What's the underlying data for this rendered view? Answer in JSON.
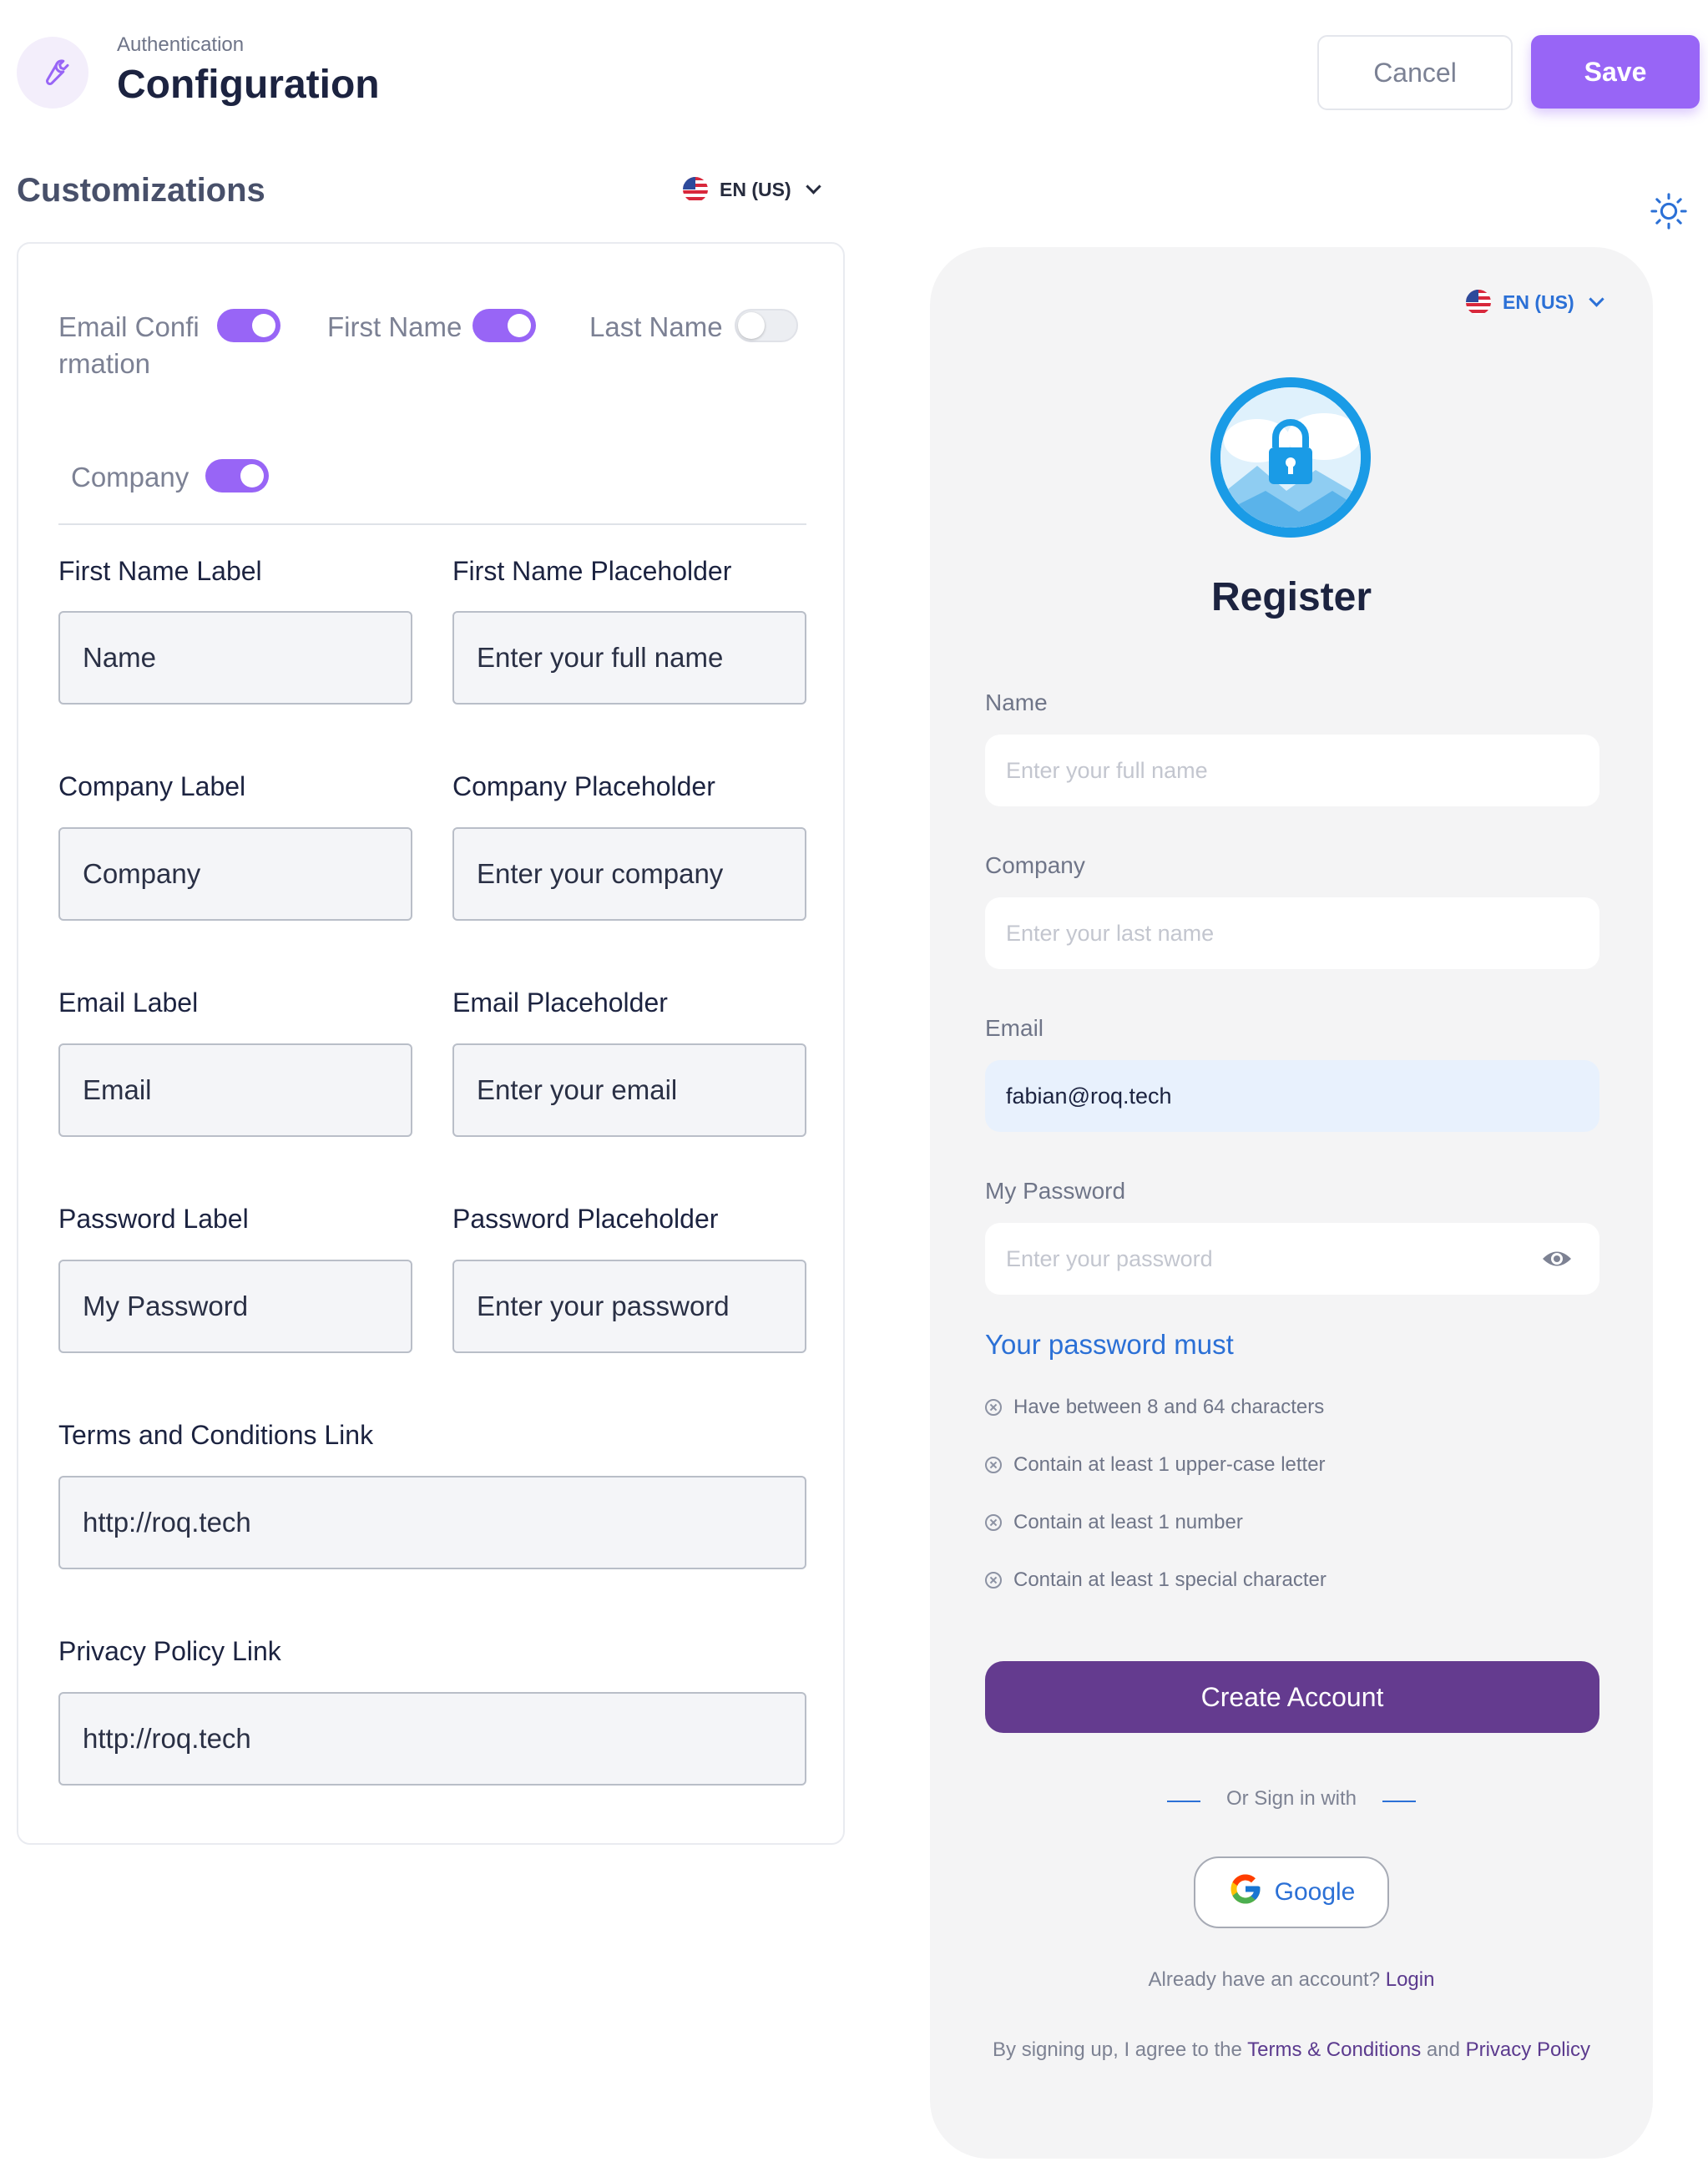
{
  "header": {
    "breadcrumb": "Authentication",
    "title": "Configuration",
    "icon": "wrench-icon",
    "cancel_label": "Cancel",
    "save_label": "Save"
  },
  "customizations": {
    "title": "Customizations",
    "language": "EN (US)",
    "toggles": [
      {
        "label": "Email Confirmation",
        "on": true
      },
      {
        "label": "First Name",
        "on": true
      },
      {
        "label": "Last Name",
        "on": false
      },
      {
        "label": "Company",
        "on": true
      }
    ],
    "fields": {
      "first_name_label": {
        "label": "First Name Label",
        "value": "Name"
      },
      "first_name_placeholder": {
        "label": "First Name Placeholder",
        "value": "Enter your full name"
      },
      "company_label": {
        "label": "Company Label",
        "value": "Company"
      },
      "company_placeholder": {
        "label": "Company Placeholder",
        "value": "Enter your company"
      },
      "email_label": {
        "label": "Email Label",
        "value": "Email"
      },
      "email_placeholder": {
        "label": "Email Placeholder",
        "value": "Enter your email"
      },
      "password_label": {
        "label": "Password Label",
        "value": "My Password"
      },
      "password_placeholder": {
        "label": "Password Placeholder",
        "value": "Enter your password"
      },
      "terms_link": {
        "label": "Terms and Conditions Link",
        "value": "http://roq.tech"
      },
      "privacy_link": {
        "label": "Privacy Policy Link",
        "value": "http://roq.tech"
      }
    }
  },
  "preview": {
    "language": "EN (US)",
    "title": "Register",
    "name": {
      "label": "Name",
      "placeholder": "Enter your full name"
    },
    "company": {
      "label": "Company",
      "placeholder": "Enter your last name"
    },
    "email": {
      "label": "Email",
      "value": "fabian@roq.tech"
    },
    "password": {
      "label": "My Password",
      "placeholder": "Enter your password"
    },
    "password_rules_title": "Your password must",
    "password_rules": [
      "Have between 8 and 64 characters",
      "Contain at least 1 upper-case letter",
      "Contain at least 1 number",
      "Contain at least 1 special character"
    ],
    "create_label": "Create Account",
    "or_sign_in": "Or Sign in with",
    "google_label": "Google",
    "already_text": "Already have an account?",
    "login_label": "Login",
    "agree_prefix": "By signing up, I agree to the",
    "terms_label": "Terms & Conditions",
    "and_text": "and",
    "privacy_label": "Privacy Policy"
  },
  "colors": {
    "accent": "#9865f6",
    "create_button": "#643b8f",
    "link_blue": "#2b70d6"
  }
}
